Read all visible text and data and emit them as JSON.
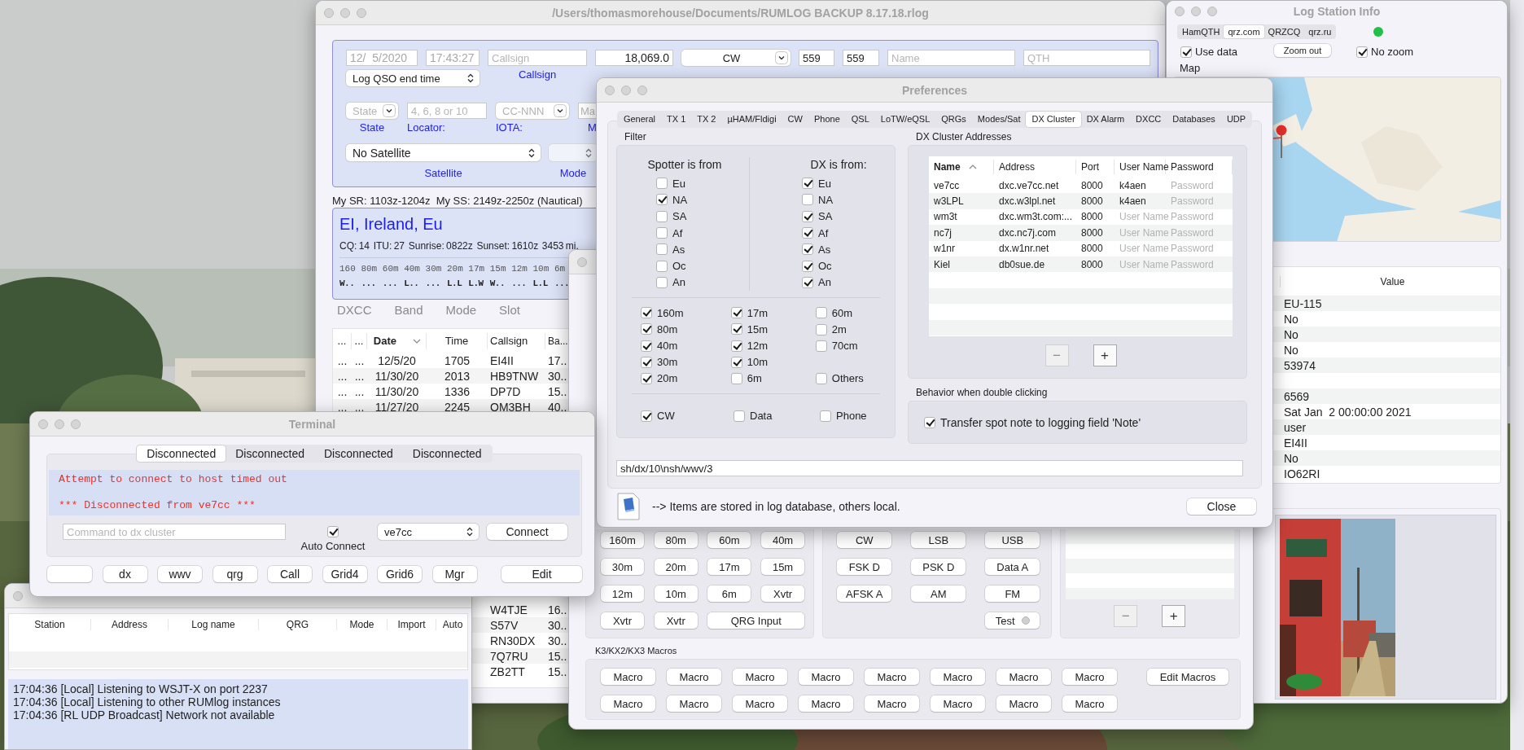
{
  "main_window": {
    "title": "/Users/thomasmorehouse/Documents/RUMLOG BACKUP 8.17.18.rlog",
    "qso_entry": {
      "date": {
        "value": "12/  5/2020",
        "disabled": true
      },
      "time": {
        "value": "17:43:27",
        "disabled": true
      },
      "time_option": "Log QSO end time",
      "callsign": {
        "placeholder": "Callsign",
        "label": "Callsign"
      },
      "frequency": {
        "value": "18,069.0"
      },
      "mode": {
        "value": "CW"
      },
      "tx": {
        "value": "559"
      },
      "rx": {
        "value": "559"
      },
      "name": {
        "placeholder": "Name"
      },
      "qth": {
        "placeholder": "QTH"
      },
      "state": {
        "placeholder": "State",
        "label": "State"
      },
      "locator": {
        "placeholder": "4, 6, 8 or 10",
        "label": "Locator:"
      },
      "iota": {
        "placeholder": "CC-NNN",
        "label": "IOTA:"
      },
      "manager": {
        "placeholder": "Ma",
        "label": "M"
      },
      "satellite": {
        "value": "No Satellite",
        "label": "Satellite"
      },
      "sat_mode": {
        "label": "Mode"
      }
    },
    "sun_info": "My SR: 1103z-1204z  My SS: 2149z-2250z (Nautical)",
    "dxcc_info": {
      "entity": "EI, Ireland, Eu",
      "details": "CQ: 14  ITU: 27  Sunrise: 0822z  Sunset: 1610z  3453 mi.",
      "bands": [
        {
          "band": "160",
          "status": "W.."
        },
        {
          "band": "80m",
          "status": "..."
        },
        {
          "band": "60m",
          "status": "..."
        },
        {
          "band": "40m",
          "status": "L.."
        },
        {
          "band": "30m",
          "status": "..."
        },
        {
          "band": "20m",
          "status": "L.L"
        },
        {
          "band": "17m",
          "status": "L.W"
        },
        {
          "band": "15m",
          "status": "W.."
        },
        {
          "band": "12m",
          "status": "..."
        },
        {
          "band": "10m",
          "status": "L.L"
        },
        {
          "band": "6m",
          "status": "..."
        }
      ]
    },
    "view_tabs": [
      {
        "label": "DXCC",
        "selected": false
      },
      {
        "label": "Band",
        "selected": false
      },
      {
        "label": "Mode",
        "selected": false
      },
      {
        "label": "Slot",
        "selected": false
      }
    ],
    "log_table": {
      "columns": [
        "...",
        "...",
        "Date",
        "Time",
        "Callsign",
        "Ba..."
      ],
      "rows": [
        {
          "cells": [
            "...",
            "...",
            "12/5/20",
            "1705",
            "EI4II",
            "17.."
          ]
        },
        {
          "cells": [
            "...",
            "...",
            "11/30/20",
            "2013",
            "HB9TNW",
            "30.."
          ]
        },
        {
          "cells": [
            "...",
            "...",
            "11/30/20",
            "1336",
            "DP7D",
            "15.."
          ]
        },
        {
          "cells": [
            "...",
            "...",
            "11/27/20",
            "2245",
            "OM3BH",
            "40.."
          ]
        }
      ],
      "lower_rows": [
        {
          "callsign": "W4TJE",
          "band": "16.."
        },
        {
          "callsign": "S57V",
          "band": "30.."
        },
        {
          "callsign": "RN30DX",
          "band": "30.."
        },
        {
          "callsign": "7Q7RU",
          "band": "15.."
        },
        {
          "callsign": "ZB2TT",
          "band": "15.."
        }
      ]
    }
  },
  "radio_window": {
    "band_buttons": [
      {
        "label": "160m"
      },
      {
        "label": "80m"
      },
      {
        "label": "60m"
      },
      {
        "label": "40m"
      },
      {
        "label": "30m"
      },
      {
        "label": "20m"
      },
      {
        "label": "17m"
      },
      {
        "label": "15m"
      },
      {
        "label": "12m"
      },
      {
        "label": "10m"
      },
      {
        "label": "6m"
      },
      {
        "label": "Xvtr"
      },
      {
        "label": "Xvtr"
      },
      {
        "label": "Xvtr"
      },
      {
        "label": "QRG Input",
        "wide": true
      }
    ],
    "mode_buttons": [
      "CW",
      "LSB",
      "USB",
      "FSK D",
      "PSK D",
      "Data A",
      "AFSK A",
      "AM",
      "FM"
    ],
    "test_button": {
      "label": "Test",
      "on": false
    },
    "list_buttons": [
      {
        "label": "−",
        "disabled": true
      },
      {
        "label": "+",
        "disabled": false
      }
    ],
    "macros_title": "K3/KX2/KX3 Macros",
    "macros": [
      "Macro",
      "Macro",
      "Macro",
      "Macro",
      "Macro",
      "Macro",
      "Macro",
      "Macro",
      "Macro",
      "Macro",
      "Macro",
      "Macro",
      "Macro",
      "Macro",
      "Macro",
      "Macro"
    ],
    "edit_macros": "Edit Macros"
  },
  "preferences": {
    "title": "Preferences",
    "tabs": [
      {
        "label": "General",
        "selected": false
      },
      {
        "label": "TX 1",
        "selected": false
      },
      {
        "label": "TX 2",
        "selected": false
      },
      {
        "label": "µHAM/Fldigi",
        "selected": false
      },
      {
        "label": "CW",
        "selected": false
      },
      {
        "label": "Phone",
        "selected": false
      },
      {
        "label": "QSL",
        "selected": false
      },
      {
        "label": "LoTW/eQSL",
        "selected": false
      },
      {
        "label": "QRGs",
        "selected": false
      },
      {
        "label": "Modes/Sat",
        "selected": false
      },
      {
        "label": "DX Cluster",
        "selected": true
      },
      {
        "label": "DX Alarm",
        "selected": false
      },
      {
        "label": "DXCC",
        "selected": false
      },
      {
        "label": "Databases",
        "selected": false
      },
      {
        "label": "UDP",
        "selected": false
      }
    ],
    "filter": {
      "title": "Filter",
      "spotter": {
        "title": "Spotter is from",
        "items": [
          {
            "label": "Eu",
            "checked": false
          },
          {
            "label": "NA",
            "checked": true
          },
          {
            "label": "SA",
            "checked": false
          },
          {
            "label": "Af",
            "checked": false
          },
          {
            "label": "As",
            "checked": false
          },
          {
            "label": "Oc",
            "checked": false
          },
          {
            "label": "An",
            "checked": false
          }
        ]
      },
      "dx": {
        "title": "DX is from:",
        "items": [
          {
            "label": "Eu",
            "checked": true
          },
          {
            "label": "NA",
            "checked": false
          },
          {
            "label": "SA",
            "checked": true
          },
          {
            "label": "Af",
            "checked": true
          },
          {
            "label": "As",
            "checked": true
          },
          {
            "label": "Oc",
            "checked": true
          },
          {
            "label": "An",
            "checked": true
          }
        ]
      },
      "band_columns": [
        [
          {
            "label": "160m",
            "checked": true
          },
          {
            "label": "80m",
            "checked": true
          },
          {
            "label": "40m",
            "checked": true
          },
          {
            "label": "30m",
            "checked": true
          },
          {
            "label": "20m",
            "checked": true
          }
        ],
        [
          {
            "label": "17m",
            "checked": true
          },
          {
            "label": "15m",
            "checked": true
          },
          {
            "label": "12m",
            "checked": true
          },
          {
            "label": "10m",
            "checked": true
          },
          {
            "label": "6m",
            "checked": false
          }
        ],
        [
          {
            "label": "60m",
            "checked": false
          },
          {
            "label": "2m",
            "checked": false
          },
          {
            "label": "70cm",
            "checked": false
          },
          {
            "label": "Others",
            "checked": false
          }
        ]
      ],
      "modes": [
        {
          "label": "CW",
          "checked": true
        },
        {
          "label": "Data",
          "checked": false
        },
        {
          "label": "Phone",
          "checked": false
        }
      ]
    },
    "addresses": {
      "title": "DX Cluster Addresses",
      "columns": [
        "Name",
        "Address",
        "Port",
        "User Name",
        "Password"
      ],
      "rows": [
        {
          "name": "ve7cc",
          "address": "dxc.ve7cc.net",
          "port": "8000",
          "user": {
            "value": "k4aen"
          },
          "password": {
            "placeholder": "Password"
          }
        },
        {
          "name": "w3LPL",
          "address": "dxc.w3lpl.net",
          "port": "8000",
          "user": {
            "value": "k4aen"
          },
          "password": {
            "placeholder": "Password"
          }
        },
        {
          "name": "wm3t",
          "address": "dxc.wm3t.com:...",
          "port": "8000",
          "user": {
            "placeholder": "User Name"
          },
          "password": {
            "placeholder": "Password"
          }
        },
        {
          "name": "nc7j",
          "address": "dxc.nc7j.com",
          "port": "8000",
          "user": {
            "placeholder": "User Name"
          },
          "password": {
            "placeholder": "Password"
          }
        },
        {
          "name": "w1nr",
          "address": "dx.w1nr.net",
          "port": "8000",
          "user": {
            "placeholder": "User Name"
          },
          "password": {
            "placeholder": "Password"
          }
        },
        {
          "name": "Kiel",
          "address": "db0sue.de",
          "port": "8000",
          "user": {
            "placeholder": "User Name"
          },
          "password": {
            "placeholder": "Password"
          }
        }
      ],
      "buttons": [
        {
          "label": "−",
          "disabled": true
        },
        {
          "label": "+",
          "disabled": false
        }
      ]
    },
    "behavior": {
      "title": "Behavior when double clicking",
      "option": {
        "label": "Transfer spot note to logging field 'Note'",
        "checked": true
      }
    },
    "commands": "sh/dx/10\\nsh/wwv/3",
    "note": "--> Items are stored in log database, others local.",
    "close": "Close"
  },
  "log_station_info": {
    "title": "Log Station Info",
    "sources": [
      {
        "label": "HamQTH",
        "selected": false
      },
      {
        "label": "qrz.com",
        "selected": true
      },
      {
        "label": "QRZCQ",
        "selected": false
      },
      {
        "label": "qrz.ru",
        "selected": false
      }
    ],
    "status": {
      "color": "#22c04a"
    },
    "use_data": {
      "label": "Use data",
      "checked": true
    },
    "zoom_button": "Zoom out",
    "no_zoom": {
      "label": "No zoom",
      "checked": true
    },
    "map_title": "Map",
    "table_column": "Value",
    "values": [
      {
        "kind": "value",
        "value": "EU-115"
      },
      {
        "kind": "value",
        "value": "No"
      },
      {
        "kind": "value",
        "value": "No"
      },
      {
        "kind": "value",
        "value": "No"
      },
      {
        "kind": "value",
        "value": "53974"
      },
      {
        "kind": "empty"
      },
      {
        "kind": "value",
        "value": "6569"
      },
      {
        "kind": "value",
        "value": "Sat Jan  2 00:00:00 2021"
      },
      {
        "kind": "value",
        "value": "user"
      },
      {
        "kind": "value",
        "value": "EI4II"
      },
      {
        "kind": "value",
        "value": "No"
      },
      {
        "kind": "value",
        "value": "IO62RI"
      }
    ]
  },
  "network_status": {
    "columns": [
      "Station",
      "Address",
      "Log name",
      "QRG",
      "Mode",
      "Import",
      "Auto"
    ],
    "log": [
      "17:04:36 [Local] Listening to WSJT-X on port 2237",
      "17:04:36 [Local] Listening to other RUMlog instances",
      "17:04:36 [RL UDP Broadcast] Network not available"
    ]
  },
  "terminal": {
    "title": "Terminal",
    "tabs": [
      {
        "label": "Disconnected",
        "selected": true
      },
      {
        "label": "Disconnected",
        "selected": false
      },
      {
        "label": "Disconnected",
        "selected": false
      },
      {
        "label": "Disconnected",
        "selected": false
      }
    ],
    "output": [
      "Attempt to connect to host timed out",
      "*** Disconnected from ve7cc ***"
    ],
    "command": {
      "placeholder": "Command to dx cluster"
    },
    "auto_connect": {
      "label": "Auto Connect",
      "checked": true
    },
    "cluster": "ve7cc",
    "connect": "Connect",
    "buttons": [
      {
        "kind": "blank"
      },
      {
        "kind": "label",
        "label": "dx"
      },
      {
        "kind": "label",
        "label": "wwv"
      },
      {
        "kind": "label",
        "label": "qrg"
      },
      {
        "kind": "label",
        "label": "Call"
      },
      {
        "kind": "label",
        "label": "Grid4"
      },
      {
        "kind": "label",
        "label": "Grid6"
      },
      {
        "kind": "label",
        "label": "Mgr"
      }
    ],
    "edit": "Edit"
  }
}
